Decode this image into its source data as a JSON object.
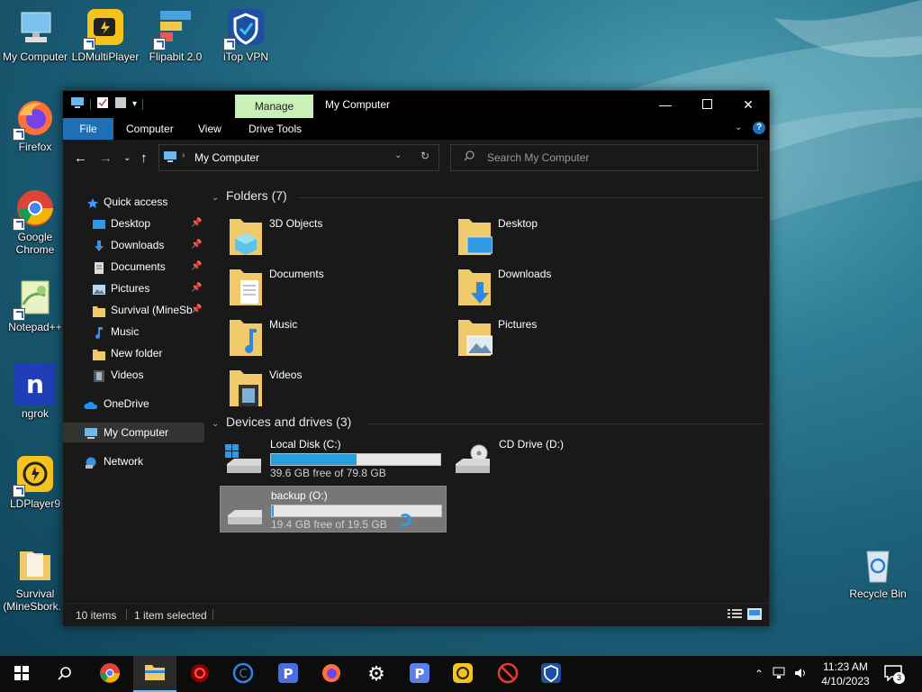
{
  "desktop": {
    "icons": [
      {
        "label": "My Computer"
      },
      {
        "label": "LDMultiPlayer"
      },
      {
        "label": "Flipabit 2.0"
      },
      {
        "label": "iTop VPN"
      },
      {
        "label": "Firefox"
      },
      {
        "label": "Google Chrome"
      },
      {
        "label": "Notepad++"
      },
      {
        "label": "ngrok"
      },
      {
        "label": "LDPlayer9"
      },
      {
        "label": "Survival (MineSbork..."
      },
      {
        "label": "Recycle Bin"
      }
    ]
  },
  "window": {
    "title": "My Computer",
    "manage_tab": "Manage",
    "ribbon_tabs": [
      "File",
      "Computer",
      "View",
      "Drive Tools"
    ],
    "address": "My Computer",
    "search_placeholder": "Search My Computer",
    "nav": [
      {
        "label": "Quick access",
        "pinned": false
      },
      {
        "label": "Desktop",
        "pinned": true
      },
      {
        "label": "Downloads",
        "pinned": true
      },
      {
        "label": "Documents",
        "pinned": true
      },
      {
        "label": "Pictures",
        "pinned": true
      },
      {
        "label": "Survival (MineSb",
        "pinned": true
      },
      {
        "label": "Music",
        "pinned": false
      },
      {
        "label": "New folder",
        "pinned": false
      },
      {
        "label": "Videos",
        "pinned": false
      },
      {
        "label": "OneDrive",
        "pinned": false
      },
      {
        "label": "My Computer",
        "pinned": false
      },
      {
        "label": "Network",
        "pinned": false
      }
    ],
    "folders_header": "Folders (7)",
    "folders": [
      "3D Objects",
      "Desktop",
      "Documents",
      "Downloads",
      "Music",
      "Pictures",
      "Videos"
    ],
    "drives_header": "Devices and drives (3)",
    "drives": [
      {
        "name": "Local Disk (C:)",
        "free": "39.6 GB free of 79.8 GB",
        "used_fraction": 0.504
      },
      {
        "name": "CD Drive (D:)",
        "free": "",
        "used_fraction": null
      },
      {
        "name": "backup (O:)",
        "free": "19.4 GB free of 19.5 GB",
        "used_fraction": 0.005
      }
    ],
    "status": {
      "items": "10 items",
      "selected": "1 item selected"
    }
  },
  "taskbar": {
    "time": "11:23 AM",
    "date": "4/10/2023",
    "notification_count": "3"
  },
  "colors": {
    "accent": "#1f6fb6",
    "manage_tab": "#c9f0b7",
    "drive_bar": "#26a0da"
  }
}
